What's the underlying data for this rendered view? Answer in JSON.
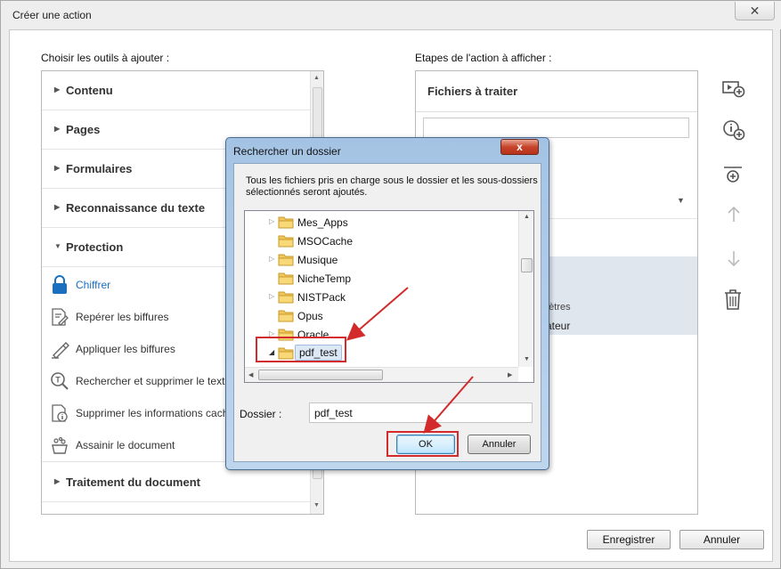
{
  "window": {
    "title": "Créer une action",
    "close_glyph": "✕"
  },
  "left": {
    "label": "Choisir les outils à ajouter :",
    "categories_top": [
      {
        "label": "Contenu",
        "expanded": false
      },
      {
        "label": "Pages",
        "expanded": false
      },
      {
        "label": "Formulaires",
        "expanded": false
      },
      {
        "label": "Reconnaissance du texte",
        "expanded": false
      },
      {
        "label": "Protection",
        "expanded": true
      }
    ],
    "tools": [
      {
        "label": "Chiffrer",
        "icon": "lock-icon",
        "active": true
      },
      {
        "label": "Repérer les biffures",
        "icon": "mark-redaction-icon",
        "active": false
      },
      {
        "label": "Appliquer les biffures",
        "icon": "apply-redaction-icon",
        "active": false
      },
      {
        "label": "Rechercher et supprimer le texte",
        "icon": "search-remove-text-icon",
        "active": false
      },
      {
        "label": "Supprimer les informations cachées",
        "icon": "remove-hidden-info-icon",
        "active": false
      },
      {
        "label": "Assainir le document",
        "icon": "sanitize-icon",
        "active": false
      }
    ],
    "categories_bottom": [
      {
        "label": "Traitement du document",
        "expanded": false
      }
    ]
  },
  "right": {
    "label": "Etapes de l'action à afficher :",
    "header": "Fichiers à traiter",
    "partial_text_1": "mètres",
    "partial_text_2": "sateur",
    "toolbar_icons": [
      "add-step-icon",
      "add-info-icon",
      "add-section-icon",
      "move-up-icon",
      "move-down-icon",
      "delete-icon"
    ]
  },
  "buttons": {
    "save": "Enregistrer",
    "cancel": "Annuler"
  },
  "dialog": {
    "title": "Rechercher un dossier",
    "close_glyph": "x",
    "description": "Tous les fichiers pris en charge sous le dossier et les sous-dossiers sélectionnés seront ajoutés.",
    "tree": [
      {
        "name": "Mes_Apps",
        "expandable": true,
        "selected": false,
        "expanded": false
      },
      {
        "name": "MSOCache",
        "expandable": false,
        "selected": false,
        "expanded": false
      },
      {
        "name": "Musique",
        "expandable": true,
        "selected": false,
        "expanded": false
      },
      {
        "name": "NicheTemp",
        "expandable": false,
        "selected": false,
        "expanded": false
      },
      {
        "name": "NISTPack",
        "expandable": true,
        "selected": false,
        "expanded": false
      },
      {
        "name": "Opus",
        "expandable": false,
        "selected": false,
        "expanded": false
      },
      {
        "name": "Oracle",
        "expandable": true,
        "selected": false,
        "expanded": false
      },
      {
        "name": "pdf_test",
        "expandable": true,
        "selected": true,
        "expanded": true
      }
    ],
    "folder_label": "Dossier :",
    "folder_value": "pdf_test",
    "ok": "OK",
    "cancel": "Annuler"
  },
  "colors": {
    "accent": "#1a6fbf",
    "annotation": "#d32b2b",
    "dialog_frame": "#a4c3e4"
  }
}
